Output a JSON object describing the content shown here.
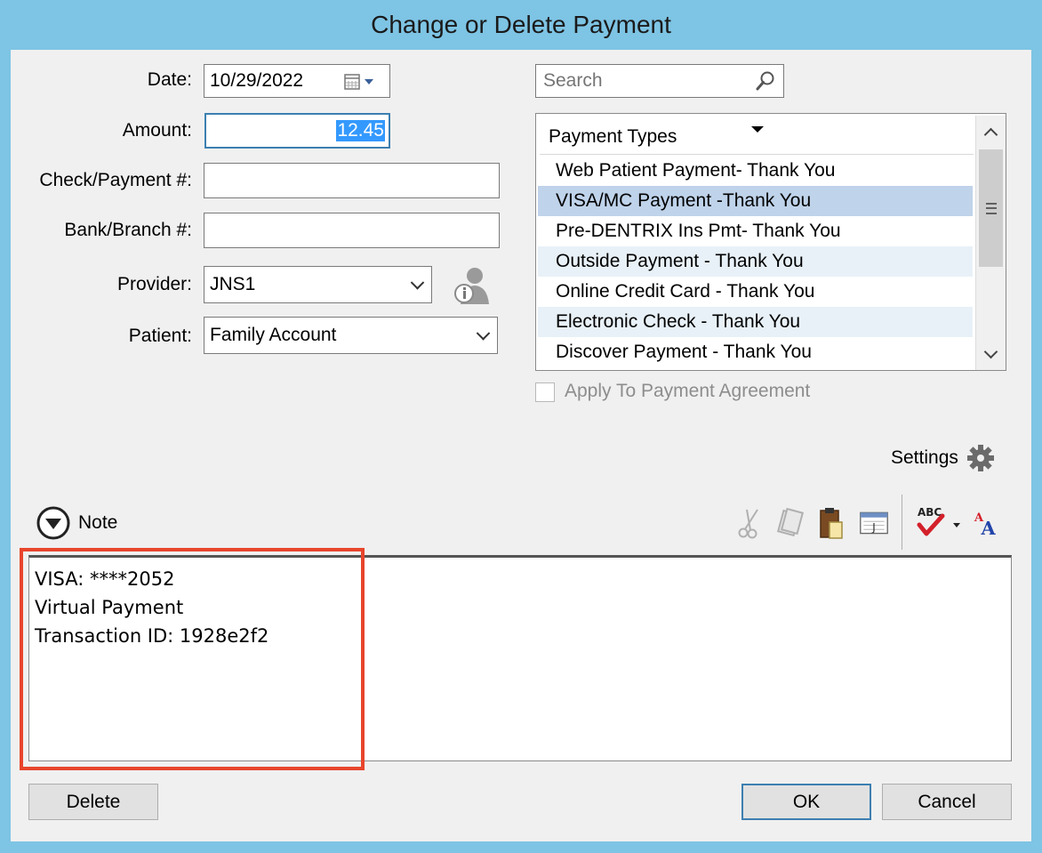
{
  "window": {
    "title": "Change or Delete Payment"
  },
  "form": {
    "date_label": "Date:",
    "date_value": "10/29/2022",
    "amount_label": "Amount:",
    "amount_value": "12.45",
    "check_label": "Check/Payment #:",
    "check_value": "",
    "bank_label": "Bank/Branch #:",
    "bank_value": "",
    "provider_label": "Provider:",
    "provider_value": "JNS1",
    "patient_label": "Patient:",
    "patient_value": "Family Account"
  },
  "search": {
    "placeholder": "Search"
  },
  "payment_types": {
    "header": "Payment Types",
    "items": [
      {
        "label": "Web Patient Payment- Thank You",
        "selected": false
      },
      {
        "label": "VISA/MC Payment -Thank You",
        "selected": true
      },
      {
        "label": "Pre-DENTRIX Ins Pmt- Thank You",
        "selected": false
      },
      {
        "label": "Outside Payment - Thank You",
        "selected": false
      },
      {
        "label": "Online Credit Card - Thank You",
        "selected": false
      },
      {
        "label": "Electronic Check - Thank You",
        "selected": false
      },
      {
        "label": "Discover Payment - Thank You",
        "selected": false
      }
    ]
  },
  "apply_agreement": {
    "label": "Apply To Payment Agreement",
    "checked": false,
    "enabled": false
  },
  "settings": {
    "label": "Settings"
  },
  "note": {
    "label": "Note",
    "lines": [
      "VISA: ****2052",
      "Virtual Payment",
      "Transaction ID: 1928e2f2"
    ]
  },
  "buttons": {
    "delete": "Delete",
    "ok": "OK",
    "cancel": "Cancel"
  },
  "toolbar": {
    "icons": [
      "scissors-icon",
      "copy-icon",
      "paste-icon",
      "insert-date-icon",
      "spellcheck-icon",
      "font-icon"
    ]
  },
  "colors": {
    "titlebar": "#7ec4e4",
    "selection": "#bfd3ea",
    "highlight": "#e8452c"
  }
}
